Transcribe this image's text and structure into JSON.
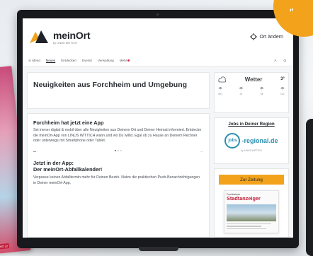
{
  "badge": {
    "text": "„"
  },
  "magazine": {
    "tag": "WO 22"
  },
  "header": {
    "logo_text": "meinOrt",
    "logo_sub": "by LINUS WITTICH",
    "location_label": "Ort ändern"
  },
  "nav": {
    "items": [
      "Menü",
      "Neues",
      "Entdecken",
      "Events",
      "Verwaltung",
      "Mehr"
    ],
    "active_index": 1,
    "right": [
      "A",
      "Q"
    ]
  },
  "hero": {
    "title": "Neuigkeiten aus Forchheim und Umgebung"
  },
  "article1": {
    "title": "Forchheim hat jetzt eine App",
    "text": "Sei immer digital & mobil über alle Neuigkeiten aus Deinem Ort und Deiner Heimat informiert. Entdecke die meinOrt-App von LINUS WITTICH wann und wo Du willst. Egal ob zu Hause an Deinem Rechner oder unterwegs mit Smartphone oder Tablet."
  },
  "article2": {
    "title": "Jetzt in der App:\nDer meinOrt-Abfallkalender!",
    "text": "Verpasse keinen Abfalltermin mehr für Deinen Bezirk. Nutze die praktischen Push-Benachrichtigungen in Deiner meinOrt-App."
  },
  "weather": {
    "title": "Wetter",
    "temp": "3°",
    "days": [
      "MO",
      "DI",
      "MI",
      "DO"
    ]
  },
  "jobs": {
    "title": "Jobs in Deiner Region",
    "logo_circle": "jobs",
    "logo_word": "-regional.de",
    "logo_sub": "by LINUS WITTICH"
  },
  "zeitung": {
    "button": "Zur Zeitung",
    "paper_small": "Forchheimer",
    "paper_name": "Stadtanzeiger"
  },
  "colors": {
    "accent": "#f2a21b",
    "brand_red": "#e2244f",
    "jobs_blue": "#2a8fb0"
  }
}
